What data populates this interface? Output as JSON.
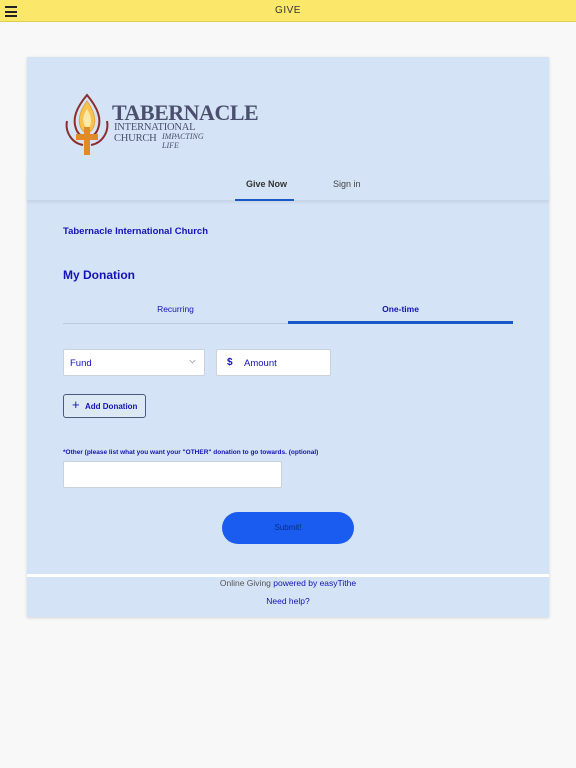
{
  "topbar": {
    "title": "GIVE",
    "menu_icon": "hamburger-menu-icon"
  },
  "logo": {
    "line1": "TABERNACLE",
    "line2": "INTERNATIONAL CHURCH",
    "line3": "IMPACTING LIFE",
    "flame_color": "#e8a33a",
    "cross_color": "#e08a28"
  },
  "main_tabs": [
    {
      "label": "Give Now",
      "active": true
    },
    {
      "label": "Sign in",
      "active": false
    }
  ],
  "church_name": "Tabernacle International Church",
  "section_title": "My Donation",
  "frequency_tabs": [
    {
      "label": "Recurring",
      "active": false
    },
    {
      "label": "One-time",
      "active": true
    }
  ],
  "form": {
    "fund_label": "Fund",
    "amount_placeholder": "Amount",
    "currency_symbol": "$",
    "add_donation_label": "Add Donation",
    "other_label": "*Other (please list what you want your \"OTHER\" donation to go towards.  (optional)",
    "other_value": "",
    "submit_label": "Submit!"
  },
  "footer": {
    "prefix": "Online Giving ",
    "powered_by": "powered by easyTithe",
    "help": "Need help?"
  },
  "colors": {
    "topbar": "#fbe86b",
    "card": "#d4e3f5",
    "accent": "#1a57c7",
    "text_primary": "#1313b8",
    "submit": "#1a5cf0"
  }
}
